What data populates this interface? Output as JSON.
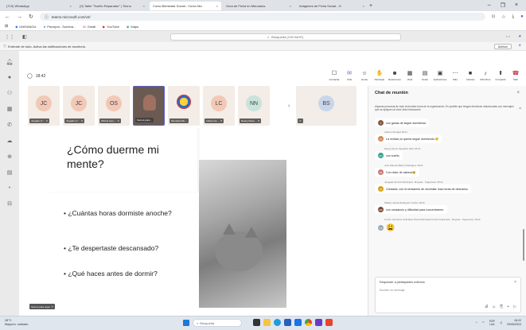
{
  "browser": {
    "tabs": [
      {
        "label": "(719) WhatsApp",
        "active": false
      },
      {
        "label": "(9) Taller \"Sueño Reparador\" | Tecno",
        "active": false
      },
      {
        "label": "Curso Bienestar Social - Curso Ma",
        "active": true
      },
      {
        "label": "Guía de Ficha en Mercados",
        "active": false
      },
      {
        "label": "Imágenes de Ficha Social - G",
        "active": false
      }
    ],
    "new_tab": "+",
    "url": "teams.microsoft.com/v2/",
    "bookmarks": [
      "UNISANGIL",
      "Principal - Sureina...",
      "Gmail",
      "YouTube",
      "Maps"
    ]
  },
  "teams": {
    "search_placeholder": "Búsqueda (Ctrl+Alt+E)",
    "notification": "Entérate de todo. Activa las notificaciones de escritorio.",
    "notification_action": "Activar",
    "timer": "18:42",
    "controls": [
      {
        "label": "Contactar",
        "icon": "☐"
      },
      {
        "label": "Chat",
        "icon": "✉"
      },
      {
        "label": "Gente",
        "icon": "☺"
      },
      {
        "label": "Participar",
        "icon": "✋"
      },
      {
        "label": "Reacciones",
        "icon": "☻"
      },
      {
        "label": "Vista",
        "icon": "▦"
      },
      {
        "label": "Notas",
        "icon": "▤"
      },
      {
        "label": "Aplicaciones",
        "icon": "▣"
      },
      {
        "label": "Más",
        "icon": "⋯"
      },
      {
        "label": "Cámara",
        "icon": "■"
      },
      {
        "label": "Micrófono",
        "icon": "♪"
      },
      {
        "label": "Compartir",
        "icon": "⬆"
      },
      {
        "label": "Salir",
        "icon": "☎"
      }
    ],
    "participants": [
      {
        "initials": "JC",
        "name": "Jurgado (Y...",
        "bg": "#f2c8b6"
      },
      {
        "initials": "JC",
        "name": "Jurgado (Y...",
        "bg": "#f2c8b6"
      },
      {
        "initials": "OS",
        "name": "Oficina Gen...",
        "bg": "#f2c8b6"
      },
      {
        "initials": "",
        "name": "Somos para...",
        "bg": "#6b5a52"
      },
      {
        "initials": "",
        "name": "Municipio Bo...",
        "bg": "#f4ece6"
      },
      {
        "initials": "LC",
        "name": "Liliana Ca...",
        "bg": "#f2c8b6"
      },
      {
        "initials": "NN",
        "name": "Nancy Rosa...",
        "bg": "#c8e4dc"
      },
      {
        "initials": "BS",
        "name": "",
        "bg": "#c8d6ea"
      }
    ],
    "strip_next": "›",
    "slide": {
      "title": "¿Cómo duerme mi mente?",
      "bullets": [
        "¿Cuántas horas dormiste anoche?",
        "¿Te despertaste descansado?",
        "¿Qué haces antes de dormir?"
      ]
    },
    "self_name": "Somos para vega"
  },
  "chat": {
    "title": "Chat de reunión",
    "note": "Algunas personas de este chat están fuera de la organización. Es posible que tengan directivas relacionadas con mensajes que se apliquen al chat. Más información",
    "messages": [
      {
        "sender": "",
        "time": "",
        "text": "con ganas de seguir durmiendo",
        "initials": "J",
        "color": "#8a5a44"
      },
      {
        "sender": "Liliana Carvajal",
        "time": "18:21",
        "text": "La verdad ¡si quería seguir durmiendo 😴",
        "initials": "LC",
        "color": "#d08a5a"
      },
      {
        "sender": "Nancy Rocío Sanabria Niño",
        "time": "18:21",
        "text": "con sueño",
        "initials": "NN",
        "color": "#3aa08a"
      },
      {
        "sender": "Jose Manuel Baron Rodriguez",
        "time": "18:21",
        "text": "Con dolor de cabeza😩",
        "initials": "JB",
        "color": "#c87878"
      },
      {
        "sender": "Juzgado 02 Civil Municipal - Boyacá - Sogamoso",
        "time": "18:22",
        "text": "Cansada, con la sensación de necesitar mas horas de descanso",
        "initials": "JZ",
        "color": "#d4a21e"
      },
      {
        "sender": "Milady Liliana Rodriguez Cortés",
        "time": "18:22",
        "text": "con cansancio y dificultad para concentrarme.",
        "initials": "MR",
        "color": "#7a4a3a"
      },
      {
        "sender": "Centro Servicios Judiciales Penal Municipal Control Garantías - Boyacá - Sogamoso",
        "time": "18:22",
        "text": "😩",
        "initials": "CS",
        "color": "#9aa8b8"
      }
    ],
    "reply_label": "Responder a participantes externos",
    "compose_placeholder": "Escribe un mensaje"
  },
  "taskbar": {
    "weather_temp": "28°C",
    "weather_desc": "Mayorm. nublado",
    "search": "Búsqueda",
    "lang": "ESP\nLAA",
    "time": "18:22",
    "date": "29/05/2024"
  },
  "colors": {
    "teams_accent": "#5b5fc7",
    "leave_red": "#c4314b"
  }
}
